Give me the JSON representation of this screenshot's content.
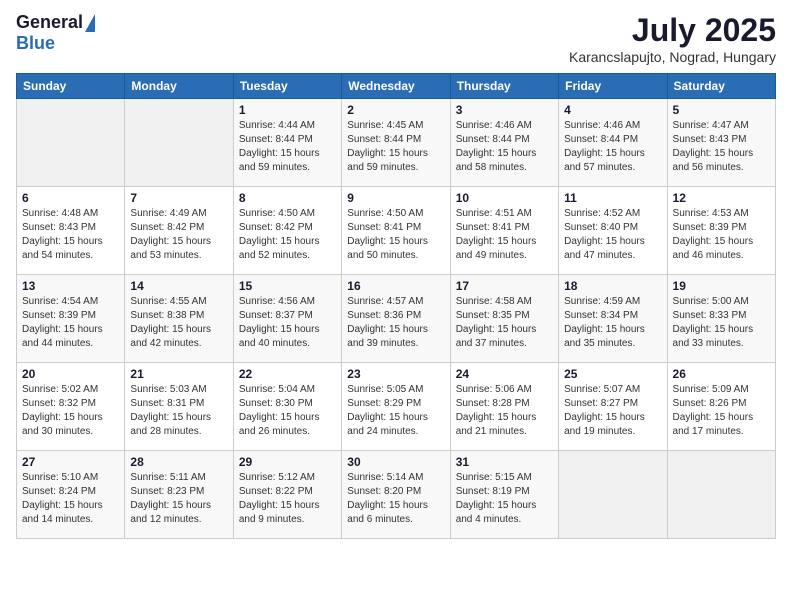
{
  "header": {
    "logo_general": "General",
    "logo_blue": "Blue",
    "title": "July 2025",
    "subtitle": "Karancslapujto, Nograd, Hungary"
  },
  "calendar": {
    "days_of_week": [
      "Sunday",
      "Monday",
      "Tuesday",
      "Wednesday",
      "Thursday",
      "Friday",
      "Saturday"
    ],
    "weeks": [
      [
        {
          "day": "",
          "info": ""
        },
        {
          "day": "",
          "info": ""
        },
        {
          "day": "1",
          "info": "Sunrise: 4:44 AM\nSunset: 8:44 PM\nDaylight: 15 hours and 59 minutes."
        },
        {
          "day": "2",
          "info": "Sunrise: 4:45 AM\nSunset: 8:44 PM\nDaylight: 15 hours and 59 minutes."
        },
        {
          "day": "3",
          "info": "Sunrise: 4:46 AM\nSunset: 8:44 PM\nDaylight: 15 hours and 58 minutes."
        },
        {
          "day": "4",
          "info": "Sunrise: 4:46 AM\nSunset: 8:44 PM\nDaylight: 15 hours and 57 minutes."
        },
        {
          "day": "5",
          "info": "Sunrise: 4:47 AM\nSunset: 8:43 PM\nDaylight: 15 hours and 56 minutes."
        }
      ],
      [
        {
          "day": "6",
          "info": "Sunrise: 4:48 AM\nSunset: 8:43 PM\nDaylight: 15 hours and 54 minutes."
        },
        {
          "day": "7",
          "info": "Sunrise: 4:49 AM\nSunset: 8:42 PM\nDaylight: 15 hours and 53 minutes."
        },
        {
          "day": "8",
          "info": "Sunrise: 4:50 AM\nSunset: 8:42 PM\nDaylight: 15 hours and 52 minutes."
        },
        {
          "day": "9",
          "info": "Sunrise: 4:50 AM\nSunset: 8:41 PM\nDaylight: 15 hours and 50 minutes."
        },
        {
          "day": "10",
          "info": "Sunrise: 4:51 AM\nSunset: 8:41 PM\nDaylight: 15 hours and 49 minutes."
        },
        {
          "day": "11",
          "info": "Sunrise: 4:52 AM\nSunset: 8:40 PM\nDaylight: 15 hours and 47 minutes."
        },
        {
          "day": "12",
          "info": "Sunrise: 4:53 AM\nSunset: 8:39 PM\nDaylight: 15 hours and 46 minutes."
        }
      ],
      [
        {
          "day": "13",
          "info": "Sunrise: 4:54 AM\nSunset: 8:39 PM\nDaylight: 15 hours and 44 minutes."
        },
        {
          "day": "14",
          "info": "Sunrise: 4:55 AM\nSunset: 8:38 PM\nDaylight: 15 hours and 42 minutes."
        },
        {
          "day": "15",
          "info": "Sunrise: 4:56 AM\nSunset: 8:37 PM\nDaylight: 15 hours and 40 minutes."
        },
        {
          "day": "16",
          "info": "Sunrise: 4:57 AM\nSunset: 8:36 PM\nDaylight: 15 hours and 39 minutes."
        },
        {
          "day": "17",
          "info": "Sunrise: 4:58 AM\nSunset: 8:35 PM\nDaylight: 15 hours and 37 minutes."
        },
        {
          "day": "18",
          "info": "Sunrise: 4:59 AM\nSunset: 8:34 PM\nDaylight: 15 hours and 35 minutes."
        },
        {
          "day": "19",
          "info": "Sunrise: 5:00 AM\nSunset: 8:33 PM\nDaylight: 15 hours and 33 minutes."
        }
      ],
      [
        {
          "day": "20",
          "info": "Sunrise: 5:02 AM\nSunset: 8:32 PM\nDaylight: 15 hours and 30 minutes."
        },
        {
          "day": "21",
          "info": "Sunrise: 5:03 AM\nSunset: 8:31 PM\nDaylight: 15 hours and 28 minutes."
        },
        {
          "day": "22",
          "info": "Sunrise: 5:04 AM\nSunset: 8:30 PM\nDaylight: 15 hours and 26 minutes."
        },
        {
          "day": "23",
          "info": "Sunrise: 5:05 AM\nSunset: 8:29 PM\nDaylight: 15 hours and 24 minutes."
        },
        {
          "day": "24",
          "info": "Sunrise: 5:06 AM\nSunset: 8:28 PM\nDaylight: 15 hours and 21 minutes."
        },
        {
          "day": "25",
          "info": "Sunrise: 5:07 AM\nSunset: 8:27 PM\nDaylight: 15 hours and 19 minutes."
        },
        {
          "day": "26",
          "info": "Sunrise: 5:09 AM\nSunset: 8:26 PM\nDaylight: 15 hours and 17 minutes."
        }
      ],
      [
        {
          "day": "27",
          "info": "Sunrise: 5:10 AM\nSunset: 8:24 PM\nDaylight: 15 hours and 14 minutes."
        },
        {
          "day": "28",
          "info": "Sunrise: 5:11 AM\nSunset: 8:23 PM\nDaylight: 15 hours and 12 minutes."
        },
        {
          "day": "29",
          "info": "Sunrise: 5:12 AM\nSunset: 8:22 PM\nDaylight: 15 hours and 9 minutes."
        },
        {
          "day": "30",
          "info": "Sunrise: 5:14 AM\nSunset: 8:20 PM\nDaylight: 15 hours and 6 minutes."
        },
        {
          "day": "31",
          "info": "Sunrise: 5:15 AM\nSunset: 8:19 PM\nDaylight: 15 hours and 4 minutes."
        },
        {
          "day": "",
          "info": ""
        },
        {
          "day": "",
          "info": ""
        }
      ]
    ]
  }
}
